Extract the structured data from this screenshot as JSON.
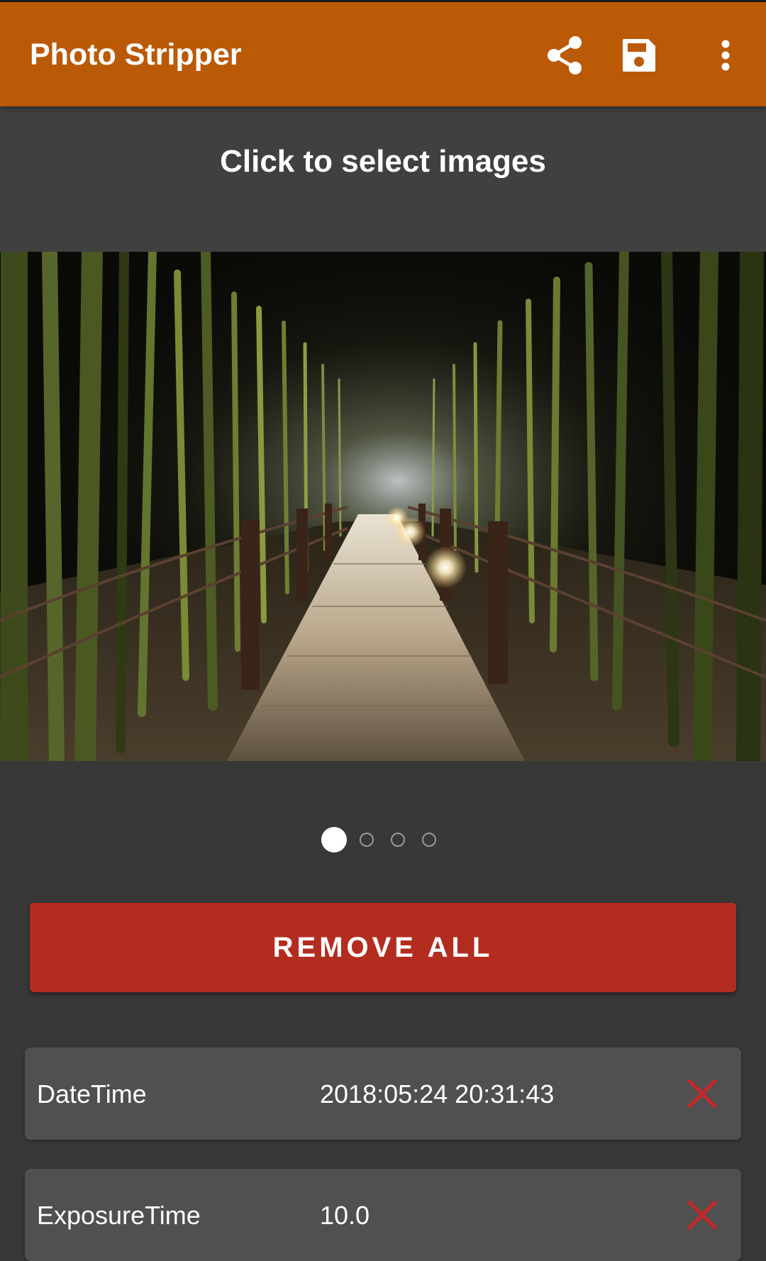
{
  "app_bar": {
    "title": "Photo Stripper",
    "background_color": "#BA5A06",
    "actions": [
      {
        "icon": "share-icon"
      },
      {
        "icon": "save-icon"
      },
      {
        "icon": "more-vert-icon"
      }
    ]
  },
  "select": {
    "label": "Click to select images"
  },
  "carousel": {
    "image": "night bamboo forest boardwalk",
    "pages": 4,
    "current_page": 1
  },
  "remove_all": {
    "label": "REMOVE ALL",
    "color": "#B32C20"
  },
  "metadata": [
    {
      "key": "DateTime",
      "value": "2018:05:24 20:31:43"
    },
    {
      "key": "ExposureTime",
      "value": "10.0"
    }
  ],
  "colors": {
    "background": "#383838",
    "row_background": "#505050",
    "remove_icon": "#C62828"
  }
}
